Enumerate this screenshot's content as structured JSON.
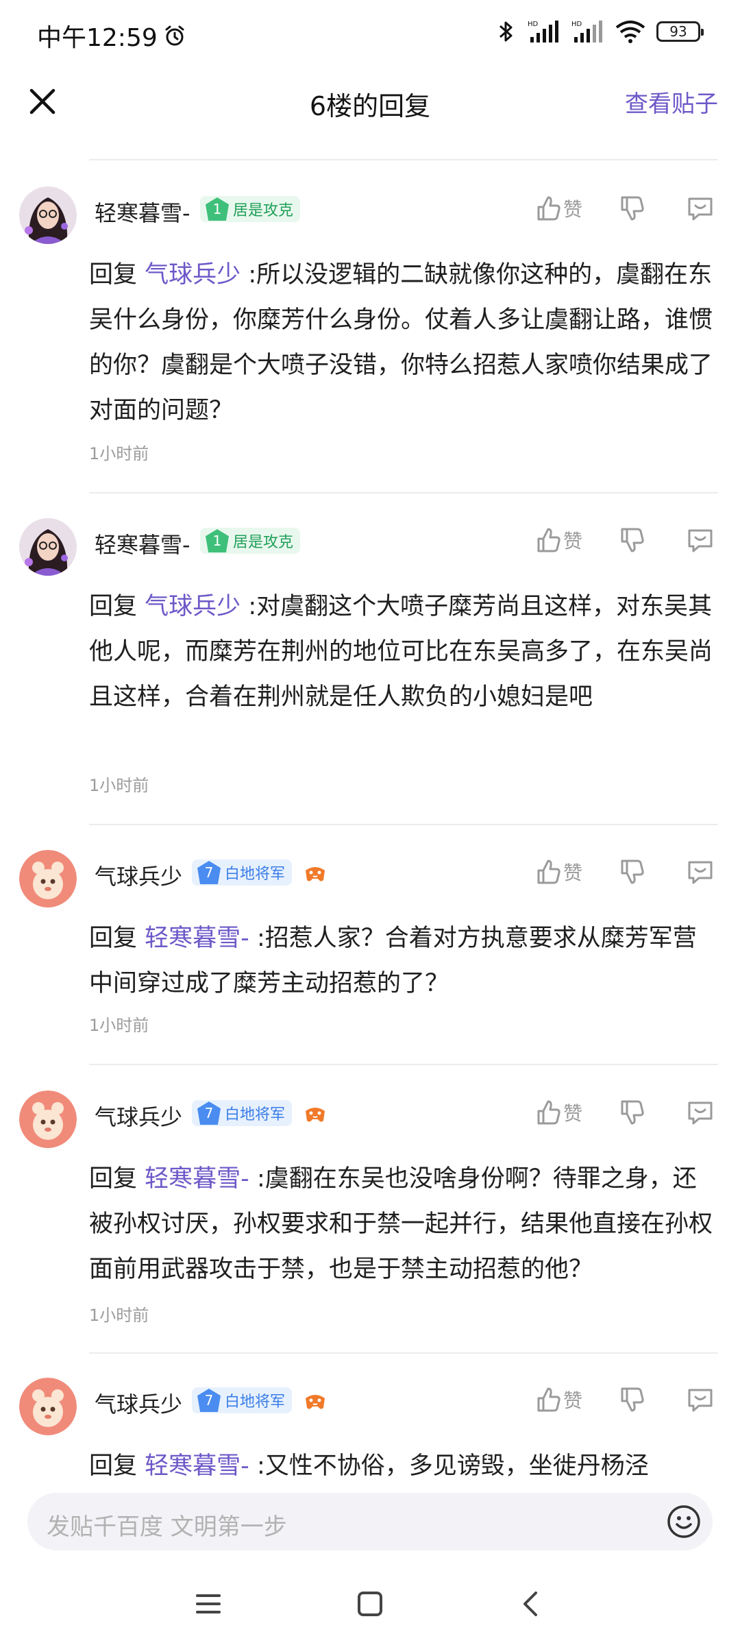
{
  "status_bar": {
    "time": "中午12:59",
    "battery": "93",
    "icons": [
      "alarm-icon",
      "bluetooth-icon",
      "signal-hd-icon",
      "signal-hd-icon",
      "wifi-icon",
      "battery-icon"
    ]
  },
  "header": {
    "title": "6楼的回复",
    "view_post": "查看贴子"
  },
  "comments": [
    {
      "username": "轻寒暮雪-",
      "level": "1",
      "badge": "居是攻克",
      "like_label": "赞",
      "reply_prefix": "回复",
      "mention": "气球兵少",
      "text": ":所以没逻辑的二缺就像你这种的，虞翻在东吴什么身份，你糜芳什么身份。仗着人多让虞翻让路，谁惯的你？虞翻是个大喷子没错，你特么招惹人家喷你结果成了对面的问题？",
      "time": "1小时前"
    },
    {
      "username": "轻寒暮雪-",
      "level": "1",
      "badge": "居是攻克",
      "like_label": "赞",
      "reply_prefix": "回复",
      "mention": "气球兵少",
      "text": ":对虞翻这个大喷子糜芳尚且这样，对东吴其他人呢，而糜芳在荆州的地位可比在东吴高多了，在东吴尚且这样，合着在荆州就是任人欺负的小媳妇是吧",
      "time": "1小时前"
    },
    {
      "username": "气球兵少",
      "level": "7",
      "badge": "白地将军",
      "like_label": "赞",
      "reply_prefix": "回复",
      "mention": "轻寒暮雪-",
      "text": ":招惹人家？合着对方执意要求从糜芳军营中间穿过成了糜芳主动招惹的了？",
      "time": "1小时前"
    },
    {
      "username": "气球兵少",
      "level": "7",
      "badge": "白地将军",
      "like_label": "赞",
      "reply_prefix": "回复",
      "mention": "轻寒暮雪-",
      "text": ":虞翻在东吴也没啥身份啊？待罪之身，还被孙权讨厌，孙权要求和于禁一起并行，结果他直接在孙权面前用武器攻击于禁，也是于禁主动招惹的他？",
      "time": "1小时前"
    },
    {
      "username": "气球兵少",
      "level": "7",
      "badge": "白地将军",
      "like_label": "赞",
      "reply_prefix": "回复",
      "mention": "轻寒暮雪-",
      "text": ":又性不协俗，多见谤毁，坐徙丹杨泾"
    }
  ],
  "input": {
    "placeholder": "发贴千百度 文明第一步"
  },
  "colors": {
    "accent": "#6e58c8",
    "badge_green": "#3fc07a",
    "badge_blue": "#4a8cf0",
    "muted": "#9b9b9b"
  }
}
